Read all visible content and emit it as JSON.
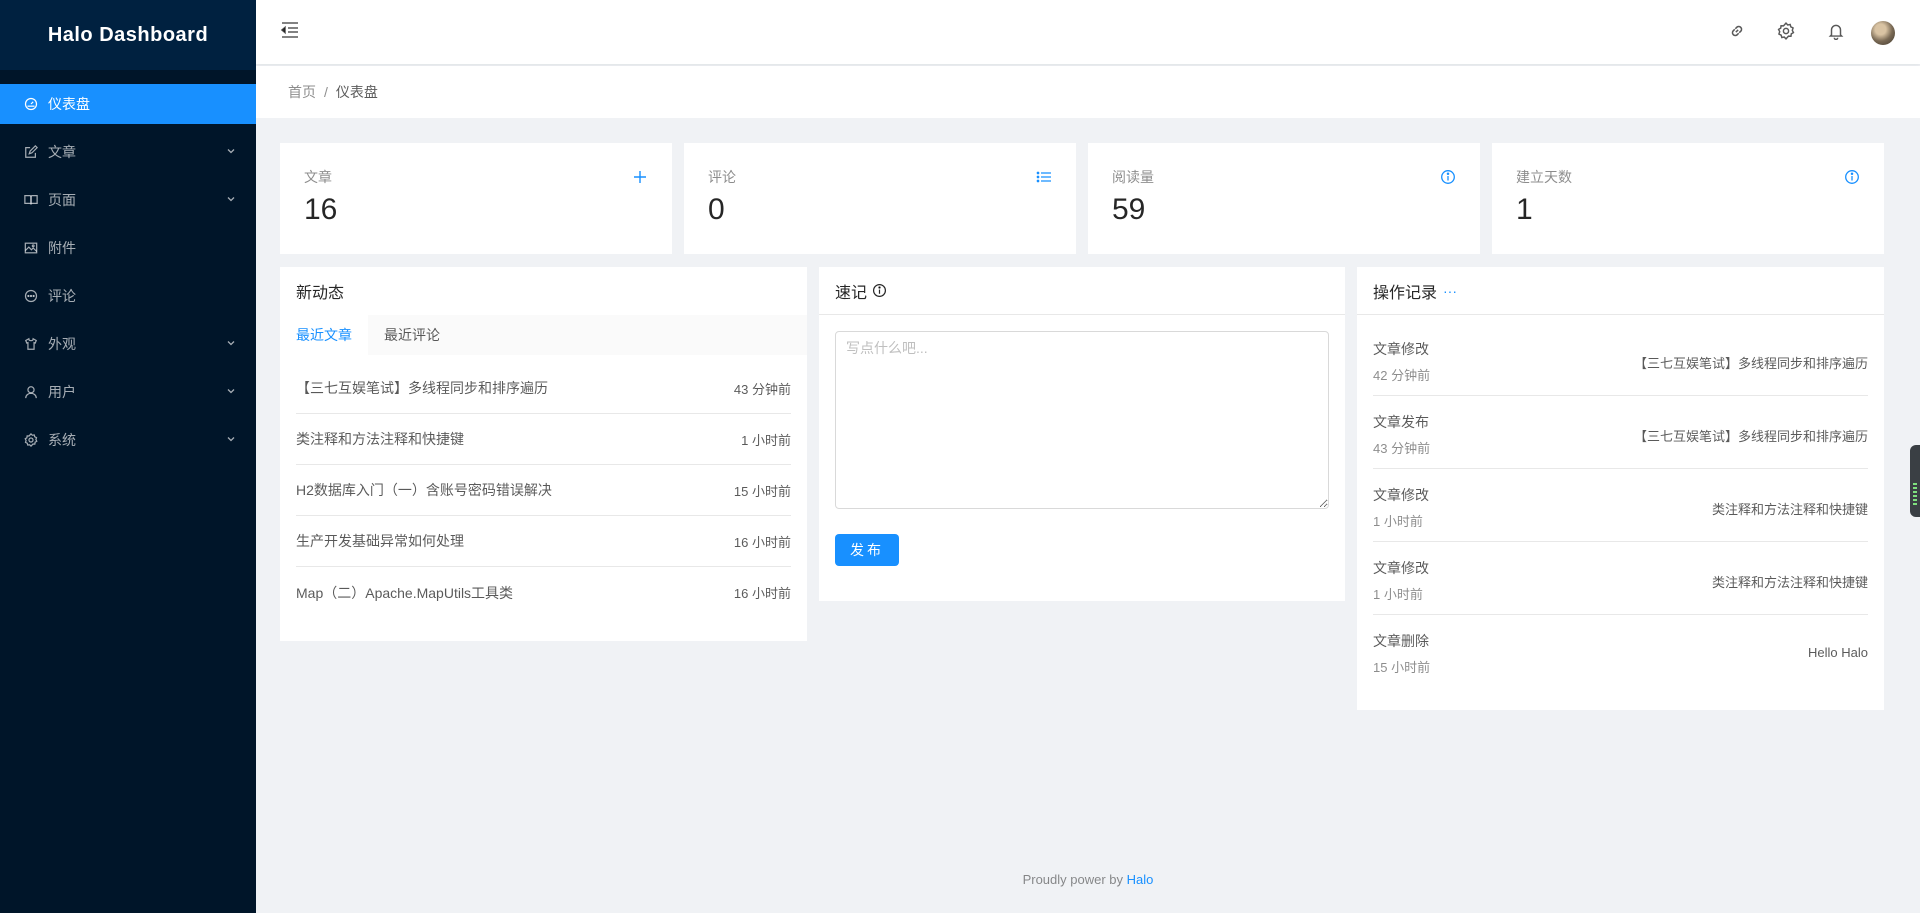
{
  "app": {
    "title": "Halo Dashboard"
  },
  "sidebar": {
    "items": [
      {
        "label": "仪表盘",
        "icon": "dashboard-icon",
        "active": true,
        "expandable": false
      },
      {
        "label": "文章",
        "icon": "edit-icon",
        "active": false,
        "expandable": true
      },
      {
        "label": "页面",
        "icon": "read-icon",
        "active": false,
        "expandable": true
      },
      {
        "label": "附件",
        "icon": "picture-icon",
        "active": false,
        "expandable": false
      },
      {
        "label": "评论",
        "icon": "message-icon",
        "active": false,
        "expandable": false
      },
      {
        "label": "外观",
        "icon": "skin-icon",
        "active": false,
        "expandable": true
      },
      {
        "label": "用户",
        "icon": "user-icon",
        "active": false,
        "expandable": true
      },
      {
        "label": "系统",
        "icon": "setting-icon",
        "active": false,
        "expandable": true
      }
    ]
  },
  "header": {
    "icons": [
      "menu-fold-icon",
      "link-icon",
      "setting-icon",
      "bell-icon",
      "avatar"
    ]
  },
  "breadcrumb": {
    "home": "首页",
    "separator": "/",
    "current": "仪表盘"
  },
  "stats": [
    {
      "label": "文章",
      "value": "16",
      "icon": "plus-icon"
    },
    {
      "label": "评论",
      "value": "0",
      "icon": "unordered-list-icon"
    },
    {
      "label": "阅读量",
      "value": "59",
      "icon": "info-circle-icon"
    },
    {
      "label": "建立天数",
      "value": "1",
      "icon": "info-circle-icon"
    }
  ],
  "activity": {
    "title": "新动态",
    "tabs": [
      "最近文章",
      "最近评论"
    ],
    "active_tab": "最近文章",
    "posts": [
      {
        "title": "【三七互娱笔试】多线程同步和排序遍历",
        "time": "43 分钟前"
      },
      {
        "title": "类注释和方法注释和快捷键",
        "time": "1 小时前"
      },
      {
        "title": "H2数据库入门（一）含账号密码错误解决",
        "time": "15 小时前"
      },
      {
        "title": "生产开发基础异常如何处理",
        "time": "16 小时前"
      },
      {
        "title": "Map（二）Apache.MapUtils工具类",
        "time": "16 小时前"
      }
    ]
  },
  "journal": {
    "title": "速记",
    "placeholder": "写点什么吧...",
    "value": "",
    "publish_label": "发布"
  },
  "logs": {
    "title": "操作记录",
    "more": "···",
    "items": [
      {
        "type": "文章修改",
        "ago": "42 分钟前",
        "content": "【三七互娱笔试】多线程同步和排序遍历"
      },
      {
        "type": "文章发布",
        "ago": "43 分钟前",
        "content": "【三七互娱笔试】多线程同步和排序遍历"
      },
      {
        "type": "文章修改",
        "ago": "1 小时前",
        "content": "类注释和方法注释和快捷键"
      },
      {
        "type": "文章修改",
        "ago": "1 小时前",
        "content": "类注释和方法注释和快捷键"
      },
      {
        "type": "文章删除",
        "ago": "15 小时前",
        "content": "Hello Halo"
      }
    ]
  },
  "footer": {
    "text": "Proudly power by",
    "link": "Halo"
  },
  "colors": {
    "primary": "#1890ff",
    "sider": "#001529",
    "logo_bg": "#002140"
  }
}
